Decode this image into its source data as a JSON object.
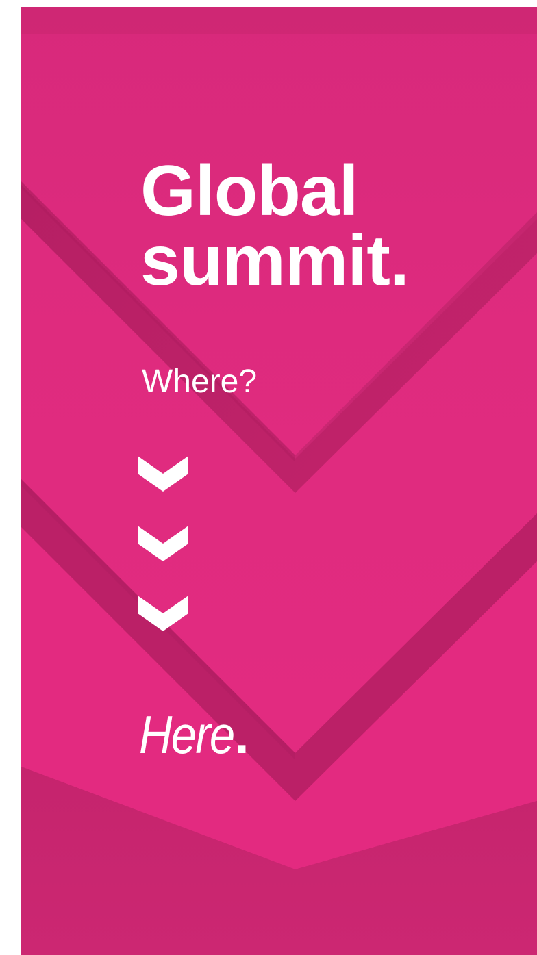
{
  "poster": {
    "headline_line1": "Global",
    "headline_line2": "summit.",
    "question": "Where?",
    "answer_word": "Here",
    "answer_dot": "."
  },
  "icons": [
    "chevron-down-icon",
    "chevron-down-icon",
    "chevron-down-icon"
  ],
  "colors": {
    "background_dark": "#b81f66",
    "background_mid": "#cf2878",
    "highlight": "#e42a80",
    "text": "#ffffff"
  }
}
